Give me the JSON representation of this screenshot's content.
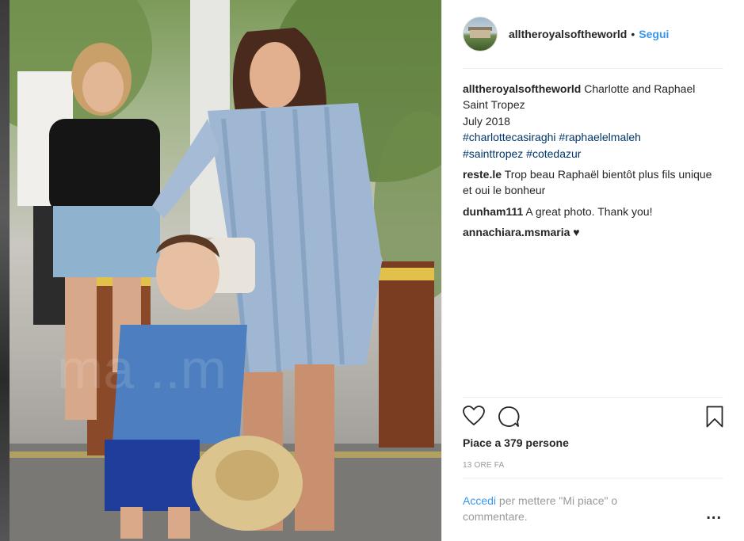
{
  "post": {
    "username": "alltheroyalsoftheworld",
    "separator": "•",
    "follow_label": "Segui"
  },
  "caption": {
    "username": "alltheroyalsoftheworld",
    "line1": "Charlotte and Raphael",
    "line2": "Saint Tropez",
    "line3": "July 2018",
    "hashtags": [
      "#charlottecasiraghi",
      "#raphaelelmaleh",
      "#sainttropez",
      "#cotedazur"
    ]
  },
  "comments": [
    {
      "user": "reste.le",
      "text": "Trop beau Raphaël bientôt plus fils unique et oui le bonheur"
    },
    {
      "user": "dunham111",
      "text": "A great photo. Thank you!"
    },
    {
      "user": "annachiara.msmaria",
      "text": "♥"
    }
  ],
  "actions": {
    "like_icon": "heart-icon",
    "comment_icon": "comment-icon",
    "save_icon": "bookmark-icon"
  },
  "likes_text": "Piace a 379 persone",
  "timestamp": "13 ORE FA",
  "login_prompt": {
    "link": "Accedi",
    "text": " per mettere \"Mi piace\" o commentare."
  },
  "more_label": "..."
}
